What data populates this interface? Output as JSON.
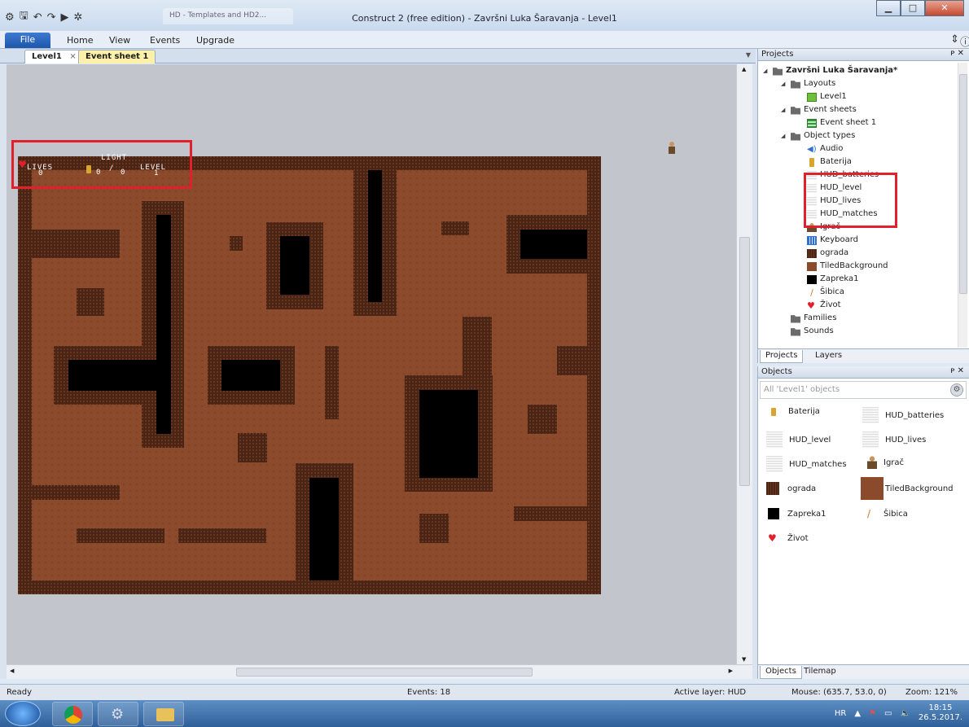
{
  "window": {
    "title": "Construct 2  (free edition) - Završni Luka Šaravanja - Level1",
    "browser_tab": "HD - Templates and HD2..."
  },
  "ribbon": {
    "file": "File",
    "menus": [
      "Home",
      "View",
      "Events",
      "Upgrade"
    ]
  },
  "doc_tabs": {
    "level1": "Level1",
    "event_sheet": "Event sheet 1"
  },
  "hud": {
    "lives_label": "LIVES",
    "lives_value": "0",
    "light_label": "LIGHT",
    "light_value": "0",
    "light_sep": "/",
    "light_max": "0",
    "level_label": "LEVEL",
    "level_value": "1"
  },
  "projects": {
    "header": "Projects",
    "root": "Završni Luka Šaravanja*",
    "layouts": "Layouts",
    "layout1": "Level1",
    "event_sheets": "Event sheets",
    "event_sheet1": "Event sheet 1",
    "object_types": "Object types",
    "types": [
      "Audio",
      "Baterija",
      "HUD_batteries",
      "HUD_level",
      "HUD_lives",
      "HUD_matches",
      "Igrač",
      "Keyboard",
      "ograda",
      "TiledBackground",
      "Zapreka1",
      "Šibica",
      "Život"
    ],
    "families": "Families",
    "sounds": "Sounds",
    "tab_projects": "Projects",
    "tab_layers": "Layers"
  },
  "objects": {
    "header": "Objects",
    "filter_placeholder": "All 'Level1' objects",
    "items": [
      "Baterija",
      "HUD_batteries",
      "HUD_level",
      "HUD_lives",
      "HUD_matches",
      "Igrač",
      "ograda",
      "TiledBackground",
      "Zapreka1",
      "Šibica",
      "Život"
    ],
    "tab_objects": "Objects",
    "tab_tilemap": "Tilemap"
  },
  "status": {
    "ready": "Ready",
    "events": "Events: 18",
    "active_layer": "Active layer: HUD",
    "mouse": "Mouse: (635.7, 53.0, 0)",
    "zoom": "Zoom: 121%"
  },
  "taskbar": {
    "lang": "HR",
    "time": "18:15",
    "date": "26.5.2017."
  },
  "colors": {
    "ground": "#8b4a2b",
    "wall": "#4a2414",
    "void": "#000000",
    "highlight": "#e0202a"
  }
}
